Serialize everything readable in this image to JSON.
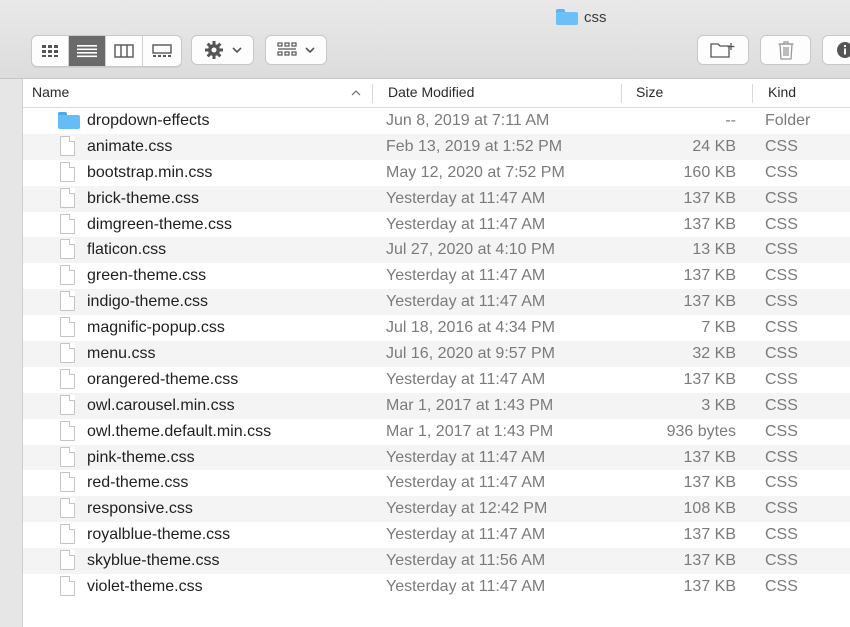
{
  "window": {
    "title": "css"
  },
  "toolbar": {
    "view_modes": [
      {
        "name": "icon-view",
        "icon": "grid-icon",
        "active": false
      },
      {
        "name": "list-view",
        "icon": "list-icon",
        "active": true
      },
      {
        "name": "column-view",
        "icon": "columns-icon",
        "active": false
      },
      {
        "name": "gallery-view",
        "icon": "gallery-icon",
        "active": false
      }
    ],
    "action_icon": "gear-icon",
    "group_icon": "group-grid-icon",
    "new_folder_icon": "new-folder-icon",
    "delete_icon": "trash-icon",
    "info_icon": "info-icon"
  },
  "columns": {
    "name": "Name",
    "date": "Date Modified",
    "size": "Size",
    "kind": "Kind"
  },
  "files": [
    {
      "name": "dropdown-effects",
      "date": "Jun 8, 2019 at 7:11 AM",
      "size": "--",
      "kind": "Folder",
      "icon": "folder-icon"
    },
    {
      "name": "animate.css",
      "date": "Feb 13, 2019 at 1:52 PM",
      "size": "24 KB",
      "kind": "CSS",
      "icon": "document-icon"
    },
    {
      "name": "bootstrap.min.css",
      "date": "May 12, 2020 at 7:52 PM",
      "size": "160 KB",
      "kind": "CSS",
      "icon": "document-icon"
    },
    {
      "name": "brick-theme.css",
      "date": "Yesterday at 11:47 AM",
      "size": "137 KB",
      "kind": "CSS",
      "icon": "document-icon"
    },
    {
      "name": "dimgreen-theme.css",
      "date": "Yesterday at 11:47 AM",
      "size": "137 KB",
      "kind": "CSS",
      "icon": "document-icon"
    },
    {
      "name": "flaticon.css",
      "date": "Jul 27, 2020 at 4:10 PM",
      "size": "13 KB",
      "kind": "CSS",
      "icon": "document-icon"
    },
    {
      "name": "green-theme.css",
      "date": "Yesterday at 11:47 AM",
      "size": "137 KB",
      "kind": "CSS",
      "icon": "document-icon"
    },
    {
      "name": "indigo-theme.css",
      "date": "Yesterday at 11:47 AM",
      "size": "137 KB",
      "kind": "CSS",
      "icon": "document-icon"
    },
    {
      "name": "magnific-popup.css",
      "date": "Jul 18, 2016 at 4:34 PM",
      "size": "7 KB",
      "kind": "CSS",
      "icon": "document-icon"
    },
    {
      "name": "menu.css",
      "date": "Jul 16, 2020 at 9:57 PM",
      "size": "32 KB",
      "kind": "CSS",
      "icon": "document-icon"
    },
    {
      "name": "orangered-theme.css",
      "date": "Yesterday at 11:47 AM",
      "size": "137 KB",
      "kind": "CSS",
      "icon": "document-icon"
    },
    {
      "name": "owl.carousel.min.css",
      "date": "Mar 1, 2017 at 1:43 PM",
      "size": "3 KB",
      "kind": "CSS",
      "icon": "document-icon"
    },
    {
      "name": "owl.theme.default.min.css",
      "date": "Mar 1, 2017 at 1:43 PM",
      "size": "936 bytes",
      "kind": "CSS",
      "icon": "document-icon"
    },
    {
      "name": "pink-theme.css",
      "date": "Yesterday at 11:47 AM",
      "size": "137 KB",
      "kind": "CSS",
      "icon": "document-icon"
    },
    {
      "name": "red-theme.css",
      "date": "Yesterday at 11:47 AM",
      "size": "137 KB",
      "kind": "CSS",
      "icon": "document-icon"
    },
    {
      "name": "responsive.css",
      "date": "Yesterday at 12:42 PM",
      "size": "108 KB",
      "kind": "CSS",
      "icon": "document-icon"
    },
    {
      "name": "royalblue-theme.css",
      "date": "Yesterday at 11:47 AM",
      "size": "137 KB",
      "kind": "CSS",
      "icon": "document-icon"
    },
    {
      "name": "skyblue-theme.css",
      "date": "Yesterday at 11:56 AM",
      "size": "137 KB",
      "kind": "CSS",
      "icon": "document-icon"
    },
    {
      "name": "violet-theme.css",
      "date": "Yesterday at 11:47 AM",
      "size": "137 KB",
      "kind": "CSS",
      "icon": "document-icon"
    }
  ],
  "colors": {
    "folder": "#66bcf5",
    "active_segment": "#6a6a6a",
    "alt_row": "#f4f4f4"
  }
}
